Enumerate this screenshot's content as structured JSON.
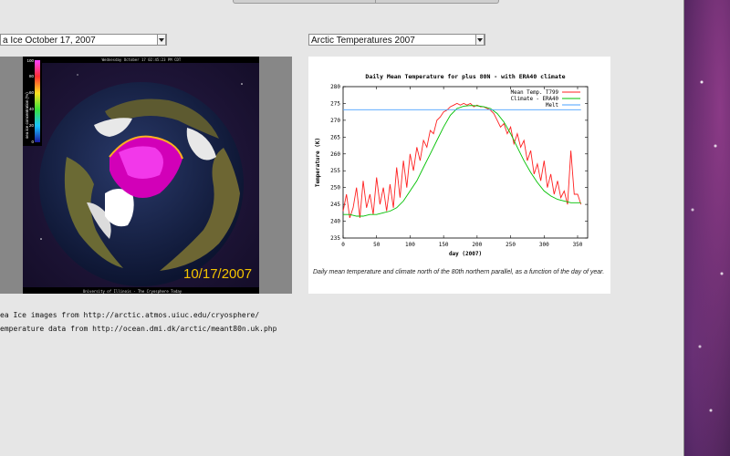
{
  "selects": {
    "ice": {
      "value": "a Ice October 17, 2007"
    },
    "temps": {
      "value": "Arctic Temperatures 2007"
    }
  },
  "ice_image": {
    "header": "Wednesday October 17 02:45:23 PM CDT",
    "legend_title": "sea ice concentration (%)",
    "legend_ticks": [
      "100",
      "80",
      "60",
      "40",
      "20",
      "0"
    ],
    "date_overlay": "10/17/2007",
    "footer": "University of Illinois - The Cryosphere Today"
  },
  "caption": "Daily mean temperature and climate north of the 80th northern parallel, as a function of the day of year.",
  "credits": {
    "ice": "ea Ice images from http://arctic.atmos.uiuc.edu/cryosphere/",
    "temps": "emperature data from http://ocean.dmi.dk/arctic/meant80n.uk.php"
  },
  "colors": {
    "mean": "#ff2020",
    "climate": "#00c000",
    "melt": "#4aa0ff"
  },
  "chart_data": {
    "type": "line",
    "title": "Daily Mean Temperature for plus 80N - with ERA40 climate",
    "xlabel": "day (2007)",
    "ylabel": "Temperature (K)",
    "xlim": [
      0,
      365
    ],
    "ylim": [
      235,
      280
    ],
    "xticks": [
      "0",
      "50",
      "100",
      "150",
      "200",
      "250",
      "300",
      "350"
    ],
    "yticks": [
      "235",
      "240",
      "245",
      "250",
      "255",
      "260",
      "265",
      "270",
      "275",
      "280"
    ],
    "legend_position": "top-right",
    "series": [
      {
        "name": "Mean Temp. T799",
        "x": [
          0,
          5,
          10,
          15,
          20,
          25,
          30,
          35,
          40,
          45,
          50,
          55,
          60,
          65,
          70,
          75,
          80,
          85,
          90,
          95,
          100,
          105,
          110,
          115,
          120,
          125,
          130,
          135,
          140,
          145,
          150,
          155,
          160,
          165,
          170,
          175,
          180,
          185,
          190,
          195,
          200,
          205,
          210,
          215,
          220,
          225,
          230,
          235,
          240,
          245,
          250,
          255,
          260,
          265,
          270,
          275,
          280,
          285,
          290,
          295,
          300,
          305,
          310,
          315,
          320,
          325,
          330,
          335,
          340,
          345,
          350,
          355
        ],
        "y": [
          243,
          248,
          241,
          244,
          250,
          241,
          252,
          244,
          248,
          242,
          253,
          245,
          250,
          243,
          251,
          244,
          256,
          247,
          258,
          250,
          260,
          255,
          262,
          258,
          264,
          262,
          267,
          266,
          270,
          271,
          272.5,
          273,
          274,
          274.5,
          275,
          274.5,
          275,
          274.5,
          275,
          274,
          274.5,
          274,
          274,
          273.5,
          273,
          272,
          270,
          268,
          269,
          266,
          268,
          263,
          266,
          262,
          264,
          258,
          261,
          254,
          257,
          252,
          258,
          250,
          254,
          248,
          252,
          247,
          249,
          245,
          261,
          248,
          248,
          245
        ]
      },
      {
        "name": "Climate - ERA40",
        "x": [
          0,
          10,
          20,
          30,
          40,
          50,
          60,
          70,
          80,
          90,
          100,
          110,
          120,
          130,
          140,
          150,
          160,
          170,
          180,
          190,
          200,
          210,
          220,
          230,
          240,
          250,
          260,
          270,
          280,
          290,
          300,
          310,
          320,
          330,
          340,
          350,
          355
        ],
        "y": [
          242,
          242,
          241.5,
          241.5,
          242,
          242,
          242.5,
          243,
          244,
          246,
          249,
          252,
          256,
          260,
          264,
          268,
          271.5,
          273.5,
          274.2,
          274.4,
          274.3,
          274,
          273.5,
          272,
          269.5,
          266,
          262,
          258,
          254.5,
          251.5,
          249,
          247.5,
          246.5,
          246,
          245.5,
          245.5,
          245.5
        ]
      },
      {
        "name": "Melt",
        "x": [
          0,
          355
        ],
        "y": [
          273.15,
          273.15
        ]
      }
    ]
  }
}
